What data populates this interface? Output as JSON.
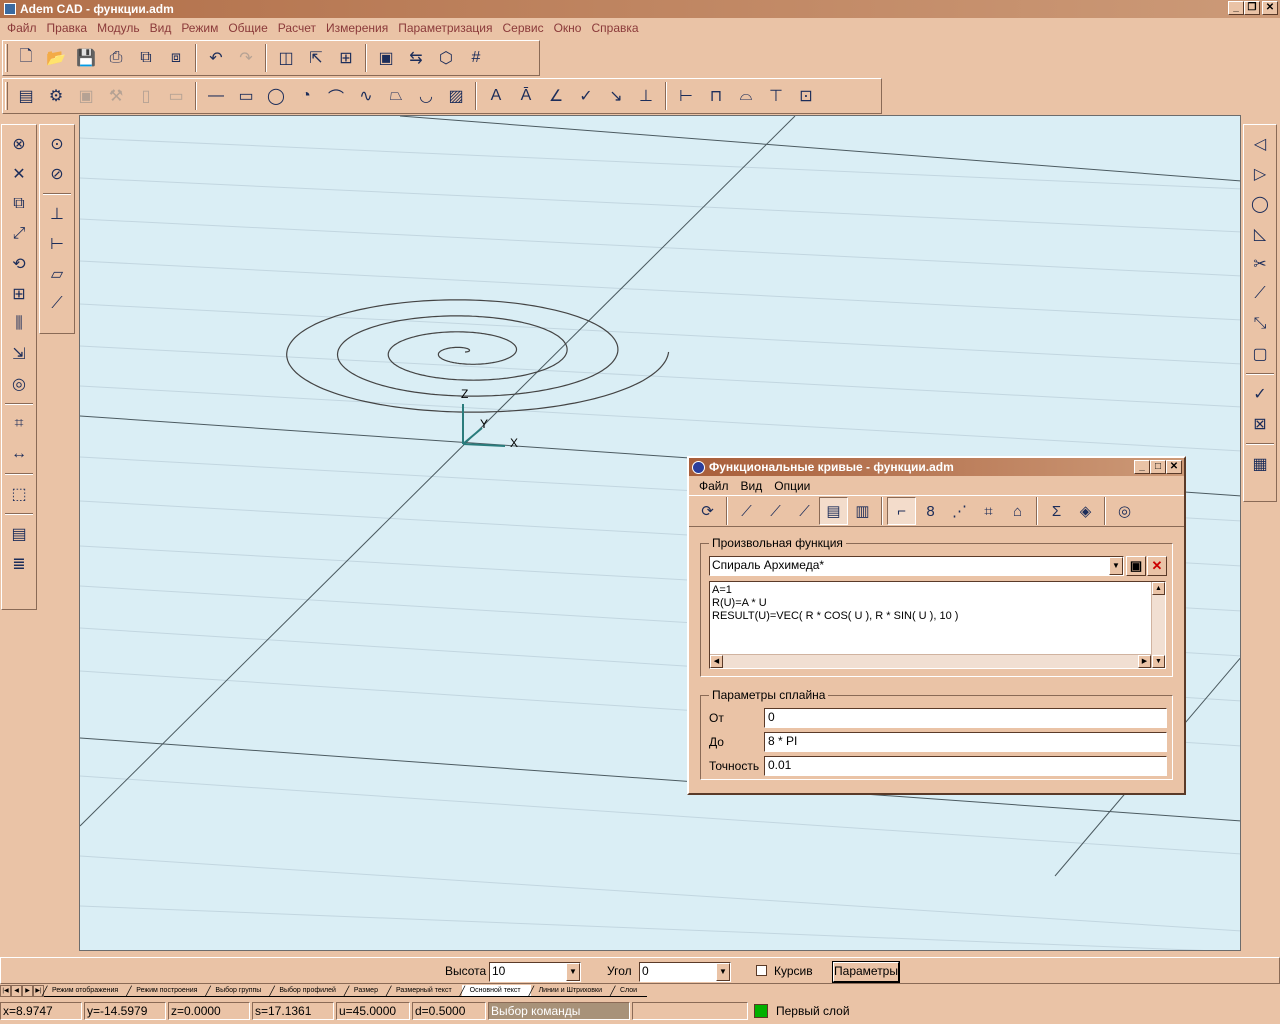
{
  "window": {
    "title": "Adem CAD - функции.adm"
  },
  "menu": [
    "Файл",
    "Правка",
    "Модуль",
    "Вид",
    "Режим",
    "Общие",
    "Расчет",
    "Измерения",
    "Параметризация",
    "Сервис",
    "Окно",
    "Справка"
  ],
  "toolbar1": [
    {
      "name": "new-file-icon",
      "glyph": "🗋"
    },
    {
      "name": "open-folder-icon",
      "glyph": "📂"
    },
    {
      "name": "save-icon",
      "glyph": "💾"
    },
    {
      "name": "print-icon",
      "glyph": "⎙"
    },
    {
      "name": "export-icon",
      "glyph": "⧉"
    },
    {
      "name": "save-all-icon",
      "glyph": "⧈"
    },
    {
      "name": "undo-icon",
      "glyph": "↶"
    },
    {
      "name": "redo-icon",
      "glyph": "↷"
    },
    {
      "name": "layers-icon",
      "glyph": "◫"
    },
    {
      "name": "pointer-icon",
      "glyph": "⇱"
    },
    {
      "name": "layer-tools-icon",
      "glyph": "⊞"
    },
    {
      "name": "save-db-icon",
      "glyph": "▣"
    },
    {
      "name": "transfer-icon",
      "glyph": "⇆"
    },
    {
      "name": "cube-icon",
      "glyph": "⬡"
    },
    {
      "name": "grid-icon",
      "glyph": "#"
    }
  ],
  "toolbar2": [
    {
      "name": "properties-icon",
      "glyph": "▤"
    },
    {
      "name": "settings-icon",
      "glyph": "⚙"
    },
    {
      "name": "save-disabled-icon",
      "glyph": "▣"
    },
    {
      "name": "tools-disabled-icon",
      "glyph": "⚒"
    },
    {
      "name": "doc-disabled-icon",
      "glyph": "▯"
    },
    {
      "name": "vdoc-disabled-icon",
      "glyph": "▭"
    },
    {
      "name": "line-icon",
      "glyph": "—"
    },
    {
      "name": "rectangle-icon",
      "glyph": "▭"
    },
    {
      "name": "circle-icon",
      "glyph": "◯"
    },
    {
      "name": "arc-icon",
      "glyph": "◔"
    },
    {
      "name": "polyline-icon",
      "glyph": "⌒"
    },
    {
      "name": "spline-icon",
      "glyph": "∿"
    },
    {
      "name": "contour-icon",
      "glyph": "⏢"
    },
    {
      "name": "ellipse-arc-icon",
      "glyph": "◡"
    },
    {
      "name": "hatch-icon",
      "glyph": "▨"
    },
    {
      "name": "text-icon",
      "glyph": "A"
    },
    {
      "name": "text-style-icon",
      "glyph": "Ā"
    },
    {
      "name": "angle-dimension-icon",
      "glyph": "∠"
    },
    {
      "name": "check-icon",
      "glyph": "✓"
    },
    {
      "name": "leader-icon",
      "glyph": "↘"
    },
    {
      "name": "tolerance-icon",
      "glyph": "⊥"
    },
    {
      "name": "dim-horizontal-icon",
      "glyph": "⊢"
    },
    {
      "name": "dim-linear-icon",
      "glyph": "⊓"
    },
    {
      "name": "dim-arc-icon",
      "glyph": "⌓"
    },
    {
      "name": "dim-vertical-icon",
      "glyph": "⊤"
    },
    {
      "name": "dim-settings-icon",
      "glyph": "⊡"
    }
  ],
  "left_tools_a": [
    {
      "name": "erase-icon",
      "glyph": "⊗"
    },
    {
      "name": "delete-icon",
      "glyph": "✕"
    },
    {
      "name": "copy-icon",
      "glyph": "⧉"
    },
    {
      "name": "move-icon",
      "glyph": "⤢"
    },
    {
      "name": "rotate-icon",
      "glyph": "⟲"
    },
    {
      "name": "array-icon",
      "glyph": "⊞"
    },
    {
      "name": "mirror-icon",
      "glyph": "⫼"
    },
    {
      "name": "scale-icon",
      "glyph": "⇲"
    },
    {
      "name": "offset-icon",
      "glyph": "◎"
    },
    {
      "name": "break-icon",
      "glyph": "⌗"
    },
    {
      "name": "stretch-icon",
      "glyph": "↔"
    },
    {
      "name": "view3d-icon",
      "glyph": "⬚"
    },
    {
      "name": "table-icon",
      "glyph": "▤"
    },
    {
      "name": "spec-icon",
      "glyph": "≣"
    }
  ],
  "left_tools_b": [
    {
      "name": "snap-center-icon",
      "glyph": "⊙"
    },
    {
      "name": "snap-delete-icon",
      "glyph": "⊘"
    },
    {
      "name": "lcs-icon",
      "glyph": "⊥"
    },
    {
      "name": "lcs-set-icon",
      "glyph": "⊢"
    },
    {
      "name": "plane-icon",
      "glyph": "▱"
    },
    {
      "name": "workplane-icon",
      "glyph": "⟋"
    }
  ],
  "right_tools": [
    {
      "name": "snap-end-icon",
      "glyph": "◁"
    },
    {
      "name": "snap-middle-icon",
      "glyph": "▷"
    },
    {
      "name": "snap-arc-icon",
      "glyph": "◯"
    },
    {
      "name": "snap-perp-icon",
      "glyph": "◺"
    },
    {
      "name": "snap-intersect-icon",
      "glyph": "✂"
    },
    {
      "name": "snap-point-icon",
      "glyph": "⟋"
    },
    {
      "name": "snap-tangent-icon",
      "glyph": "⤡"
    },
    {
      "name": "snap-near-icon",
      "glyph": "▢"
    },
    {
      "name": "snap-check-icon",
      "glyph": "✓"
    },
    {
      "name": "snap-tool-icon",
      "glyph": "⊠"
    },
    {
      "name": "snap-grid-icon",
      "glyph": "▦"
    }
  ],
  "viewport": {
    "axis_x": "X",
    "axis_y": "Y",
    "axis_z": "Z"
  },
  "dialog": {
    "title": "Функциональные кривые - функции.adm",
    "menu": [
      "Файл",
      "Вид",
      "Опции"
    ],
    "tools": [
      {
        "name": "refresh-icon",
        "glyph": "⟳"
      },
      {
        "name": "curve-plot1-icon",
        "glyph": "⟋"
      },
      {
        "name": "curve-plot2-icon",
        "glyph": "⟋"
      },
      {
        "name": "curve-plot3-icon",
        "glyph": "⟋"
      },
      {
        "name": "edit-icon",
        "glyph": "▤"
      },
      {
        "name": "list-icon",
        "glyph": "▥"
      },
      {
        "name": "polyline-curve-icon",
        "glyph": "⌐"
      },
      {
        "name": "spline-8-icon",
        "glyph": "8"
      },
      {
        "name": "dotted-curve-icon",
        "glyph": "⋰"
      },
      {
        "name": "surface-icon",
        "glyph": "⌗"
      },
      {
        "name": "building-icon",
        "glyph": "⌂"
      },
      {
        "name": "sigma-icon",
        "glyph": "Σ"
      },
      {
        "name": "layers-3d-icon",
        "glyph": "◈"
      },
      {
        "name": "spiral-icon",
        "glyph": "◎"
      }
    ],
    "group_function": {
      "label": "Произвольная функция",
      "selected": "Спираль Архимеда*",
      "code": [
        "A=1",
        "R(U)=A * U",
        "RESULT(U)=VEC( R * COS( U ), R * SIN( U ), 10 )"
      ]
    },
    "group_spline": {
      "label": "Параметры сплайна",
      "from_label": "От",
      "from_value": "0",
      "to_label": "До",
      "to_value": "8 * PI",
      "precision_label": "Точность",
      "precision_value": "0.01"
    }
  },
  "textbar": {
    "height_label": "Высота",
    "height_value": "10",
    "angle_label": "Угол",
    "angle_value": "0",
    "italic_label": "Курсив",
    "params_button": "Параметры"
  },
  "tabs": [
    "Режим отображения",
    "Режим построения",
    "Выбор группы",
    "Выбор профилей",
    "Размер",
    "Размерный текст",
    "Основной текст",
    "Линии и Штриховки",
    "Слои"
  ],
  "active_tab": "Основной текст",
  "status": {
    "x": "x=8.9747",
    "y": "y=-14.5979",
    "z": "z=0.0000",
    "s": "s=17.1361",
    "u": "u=45.0000",
    "d": "d=0.5000",
    "command": "Выбор команды",
    "empty": "",
    "layer": "Первый слой",
    "layer_color": "#00b000"
  }
}
